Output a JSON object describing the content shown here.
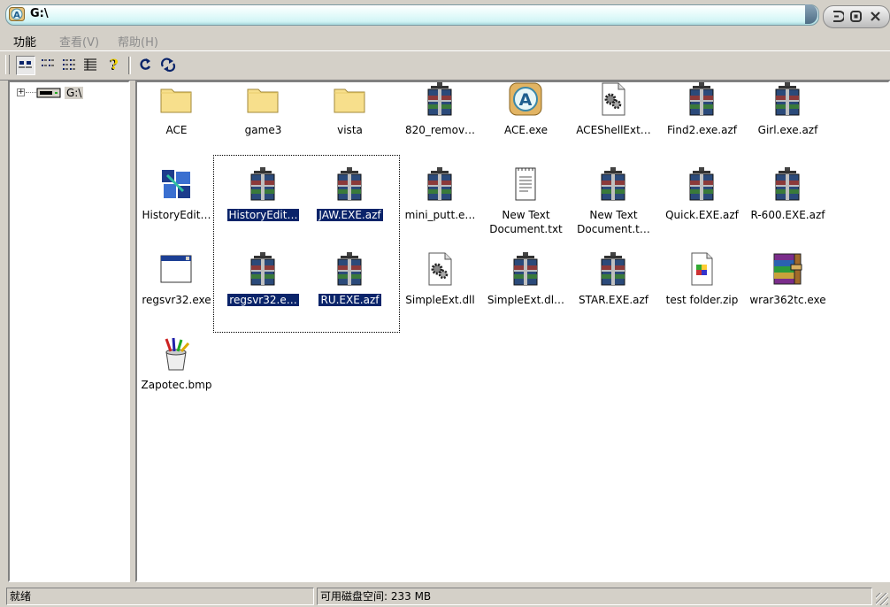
{
  "window": {
    "title": "G:\\"
  },
  "menu": [
    {
      "label": "功能",
      "disabled": false
    },
    {
      "label": "查看(V)",
      "disabled": true
    },
    {
      "label": "帮助(H)",
      "disabled": true
    }
  ],
  "tree": {
    "root_label": "G:\\"
  },
  "files": [
    {
      "name": "ACE",
      "icon": "folder-icon"
    },
    {
      "name": "game3",
      "icon": "folder-icon"
    },
    {
      "name": "vista",
      "icon": "folder-icon"
    },
    {
      "name": "820_remov…",
      "icon": "archive-icon"
    },
    {
      "name": "ACE.exe",
      "icon": "ace-app-icon"
    },
    {
      "name": "ACEShellExt…",
      "icon": "dll-gear-icon"
    },
    {
      "name": "Find2.exe.azf",
      "icon": "archive-icon"
    },
    {
      "name": "Girl.exe.azf",
      "icon": "archive-icon"
    },
    {
      "name": "HistoryEdit…",
      "icon": "cube-app-icon"
    },
    {
      "name": "HistoryEdit…",
      "icon": "archive-icon",
      "selected": true
    },
    {
      "name": "JAW.EXE.azf",
      "icon": "archive-icon",
      "selected": true
    },
    {
      "name": "mini_putt.e…",
      "icon": "archive-icon"
    },
    {
      "name": "New Text Document.txt",
      "line1": "New Text",
      "line2": "Document.txt",
      "icon": "text-document-icon"
    },
    {
      "name": "New Text Document.t…",
      "line1": "New Text",
      "line2": "Document.t…",
      "icon": "archive-icon"
    },
    {
      "name": "Quick.EXE.azf",
      "icon": "archive-icon"
    },
    {
      "name": "R-600.EXE.azf",
      "icon": "archive-icon"
    },
    {
      "name": "regsvr32.exe",
      "icon": "window-app-icon"
    },
    {
      "name": "regsvr32.e…",
      "icon": "archive-icon",
      "selected": true
    },
    {
      "name": "RU.EXE.azf",
      "icon": "archive-icon",
      "selected": true
    },
    {
      "name": "SimpleExt.dll",
      "icon": "dll-gear-icon"
    },
    {
      "name": "SimpleExt.dl…",
      "icon": "archive-icon"
    },
    {
      "name": "STAR.EXE.azf",
      "icon": "archive-icon"
    },
    {
      "name": "test folder.zip",
      "icon": "zip-document-icon"
    },
    {
      "name": "wrar362tc.exe",
      "icon": "winrar-icon"
    },
    {
      "name": "Zapotec.bmp",
      "icon": "paint-bucket-icon"
    }
  ],
  "status": {
    "left": "就绪",
    "free_space": "可用磁盘空间: 233 MB"
  }
}
